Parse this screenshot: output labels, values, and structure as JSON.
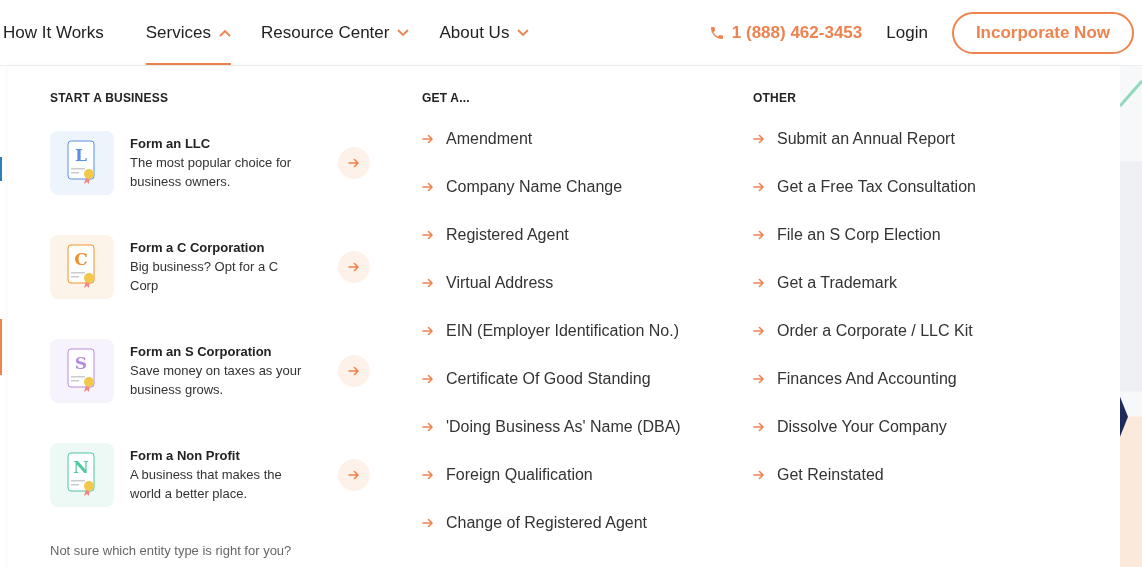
{
  "nav": {
    "items": [
      {
        "label": "How It Works",
        "kind": "link",
        "expanded": false
      },
      {
        "label": "Services",
        "kind": "dropdown",
        "expanded": true
      },
      {
        "label": "Resource Center",
        "kind": "dropdown",
        "expanded": false
      },
      {
        "label": "About Us",
        "kind": "dropdown",
        "expanded": false
      }
    ],
    "phone": "1 (888) 462-3453",
    "login": "Login",
    "cta": "Incorporate Now"
  },
  "menu": {
    "start": {
      "heading": "START A BUSINESS",
      "cards": [
        {
          "letter": "L",
          "title": "Form an LLC",
          "description": "The most popular choice for business owners.",
          "color": "#5b8fe6"
        },
        {
          "letter": "C",
          "title": "Form a C Corporation",
          "description": "Big business? Opt for a C Corp",
          "color": "#f0902c"
        },
        {
          "letter": "S",
          "title": "Form an S Corporation",
          "description": "Save money on taxes as your business grows.",
          "color": "#b38be0"
        },
        {
          "letter": "N",
          "title": "Form a Non Profit",
          "description": "A business that makes the world a better place.",
          "color": "#4fc9a0"
        }
      ],
      "footer": "Not sure which entity type is right for you?"
    },
    "get": {
      "heading": "GET A...",
      "links": [
        "Amendment",
        "Company Name Change",
        "Registered Agent",
        "Virtual Address",
        "EIN (Employer Identification No.)",
        "Certificate Of Good Standing",
        "'Doing Business As' Name (DBA)",
        "Foreign Qualification",
        "Change of Registered Agent"
      ]
    },
    "other": {
      "heading": "OTHER",
      "links": [
        "Submit an Annual Report",
        "Get a Free Tax Consultation",
        "File an S Corp Election",
        "Get a Trademark",
        "Order a Corporate / LLC Kit",
        "Finances And Accounting",
        "Dissolve Your Company",
        "Get Reinstated"
      ]
    }
  }
}
